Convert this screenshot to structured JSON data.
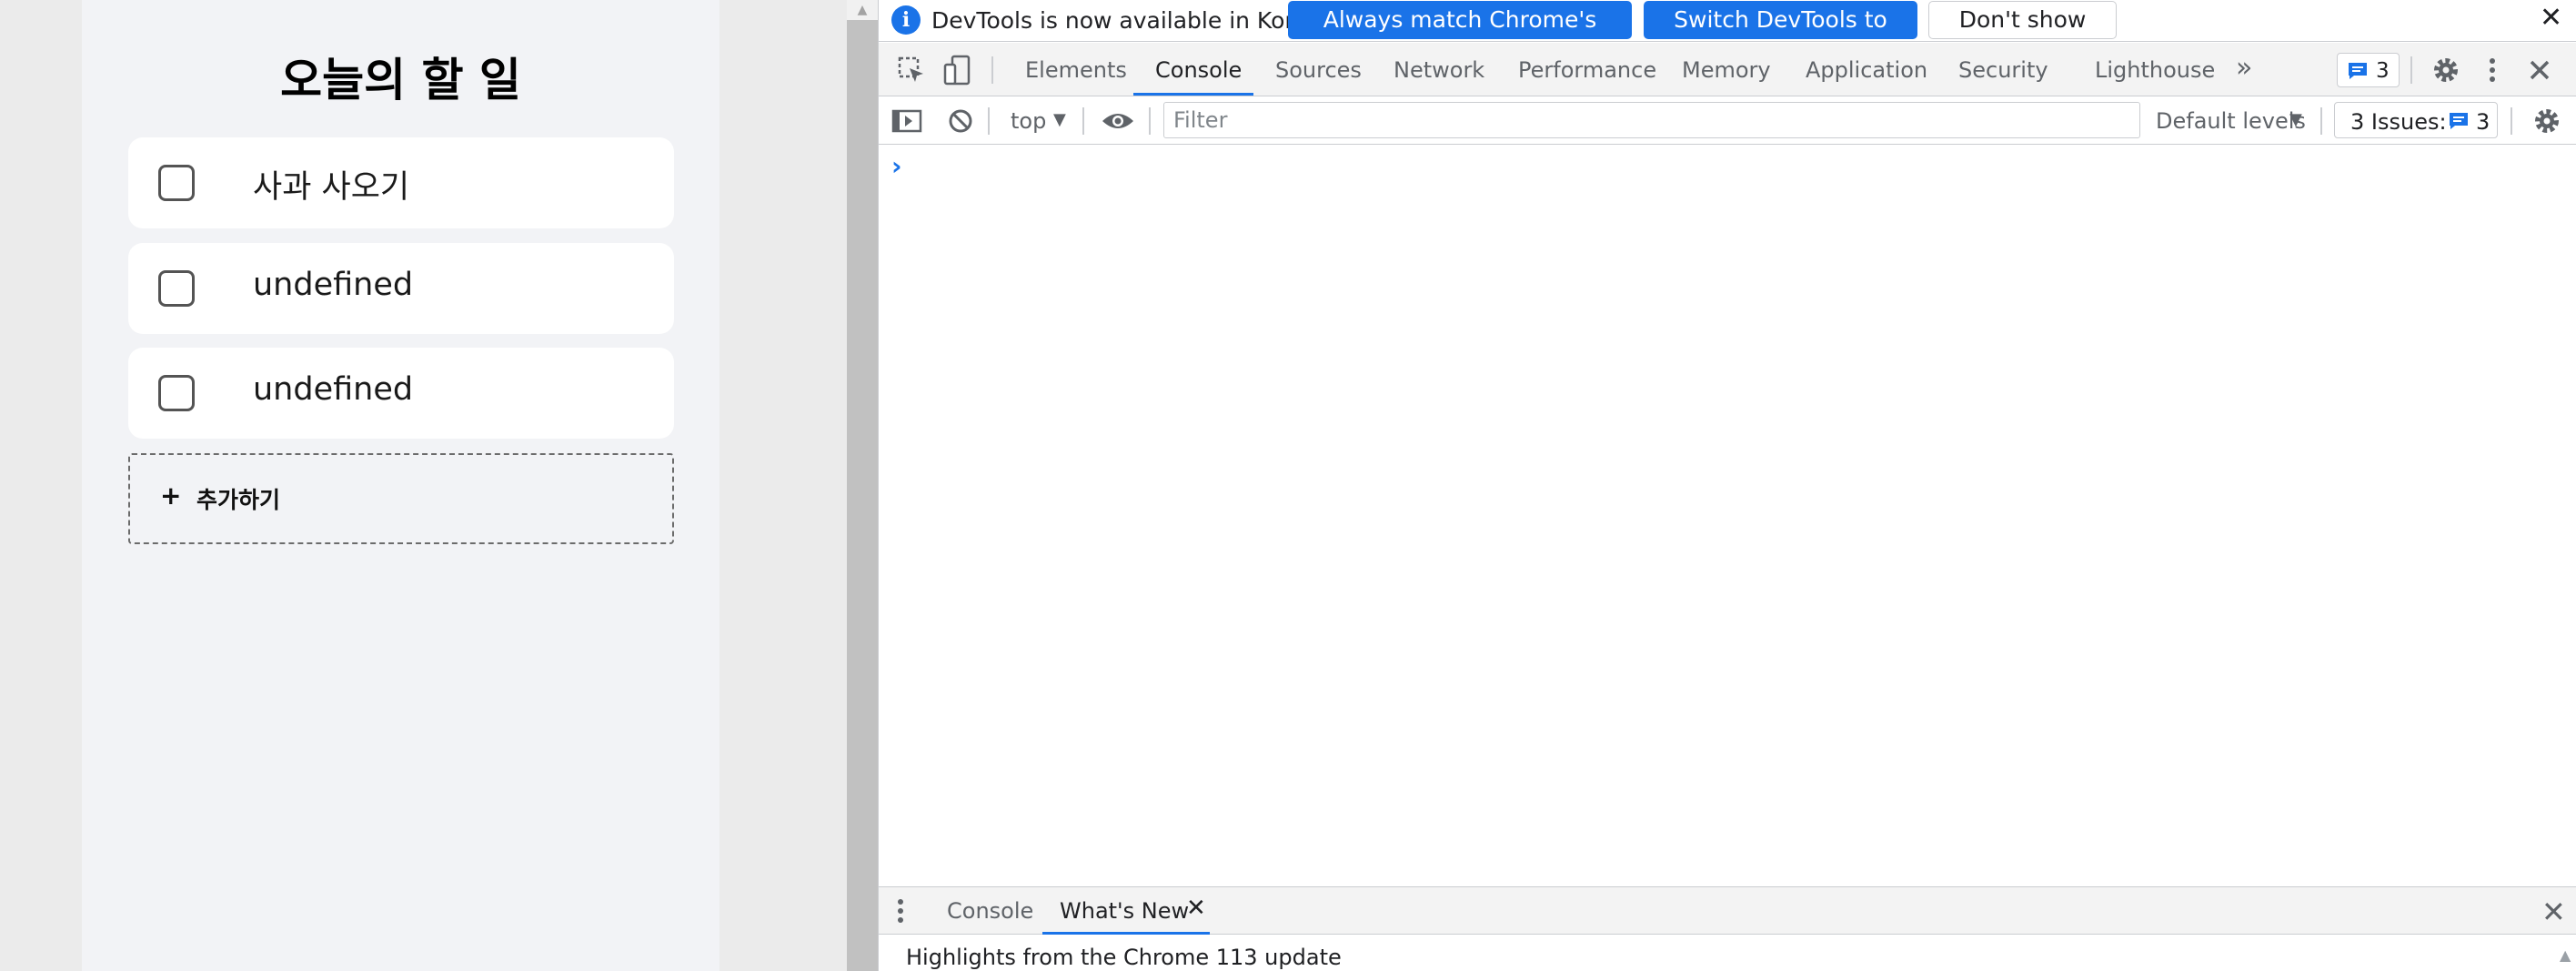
{
  "app": {
    "title": "오늘의 할 일",
    "todos": [
      {
        "text": "사과 사오기",
        "checked": false
      },
      {
        "text": "undefined",
        "checked": false
      },
      {
        "text": "undefined",
        "checked": false
      }
    ],
    "add_button": {
      "icon": "+",
      "label": "추가하기"
    }
  },
  "devtools": {
    "infobar": {
      "message": "DevTools is now available in Korean!",
      "btn_match": "Always match Chrome's language",
      "btn_switch": "Switch DevTools to Korean",
      "btn_dismiss": "Don't show again",
      "close": "✕"
    },
    "tabs": [
      "Elements",
      "Console",
      "Sources",
      "Network",
      "Performance",
      "Memory",
      "Application",
      "Security",
      "Lighthouse"
    ],
    "active_tab": "Console",
    "more_tabs": "»",
    "messages_count": "3",
    "console_toolbar": {
      "context": "top",
      "filter_placeholder": "Filter",
      "levels": "Default levels",
      "issues_label": "3 Issues:",
      "issues_count": "3"
    },
    "prompt": "›",
    "drawer": {
      "tabs": [
        "Console",
        "What's New"
      ],
      "active_tab": "What's New",
      "close_tab": "✕",
      "close": "✕",
      "highlight": "Highlights from the Chrome 113 update"
    }
  },
  "colors": {
    "accent": "#1a73e8",
    "app_bg": "#f2f3f6",
    "card_bg": "#ffffff"
  }
}
